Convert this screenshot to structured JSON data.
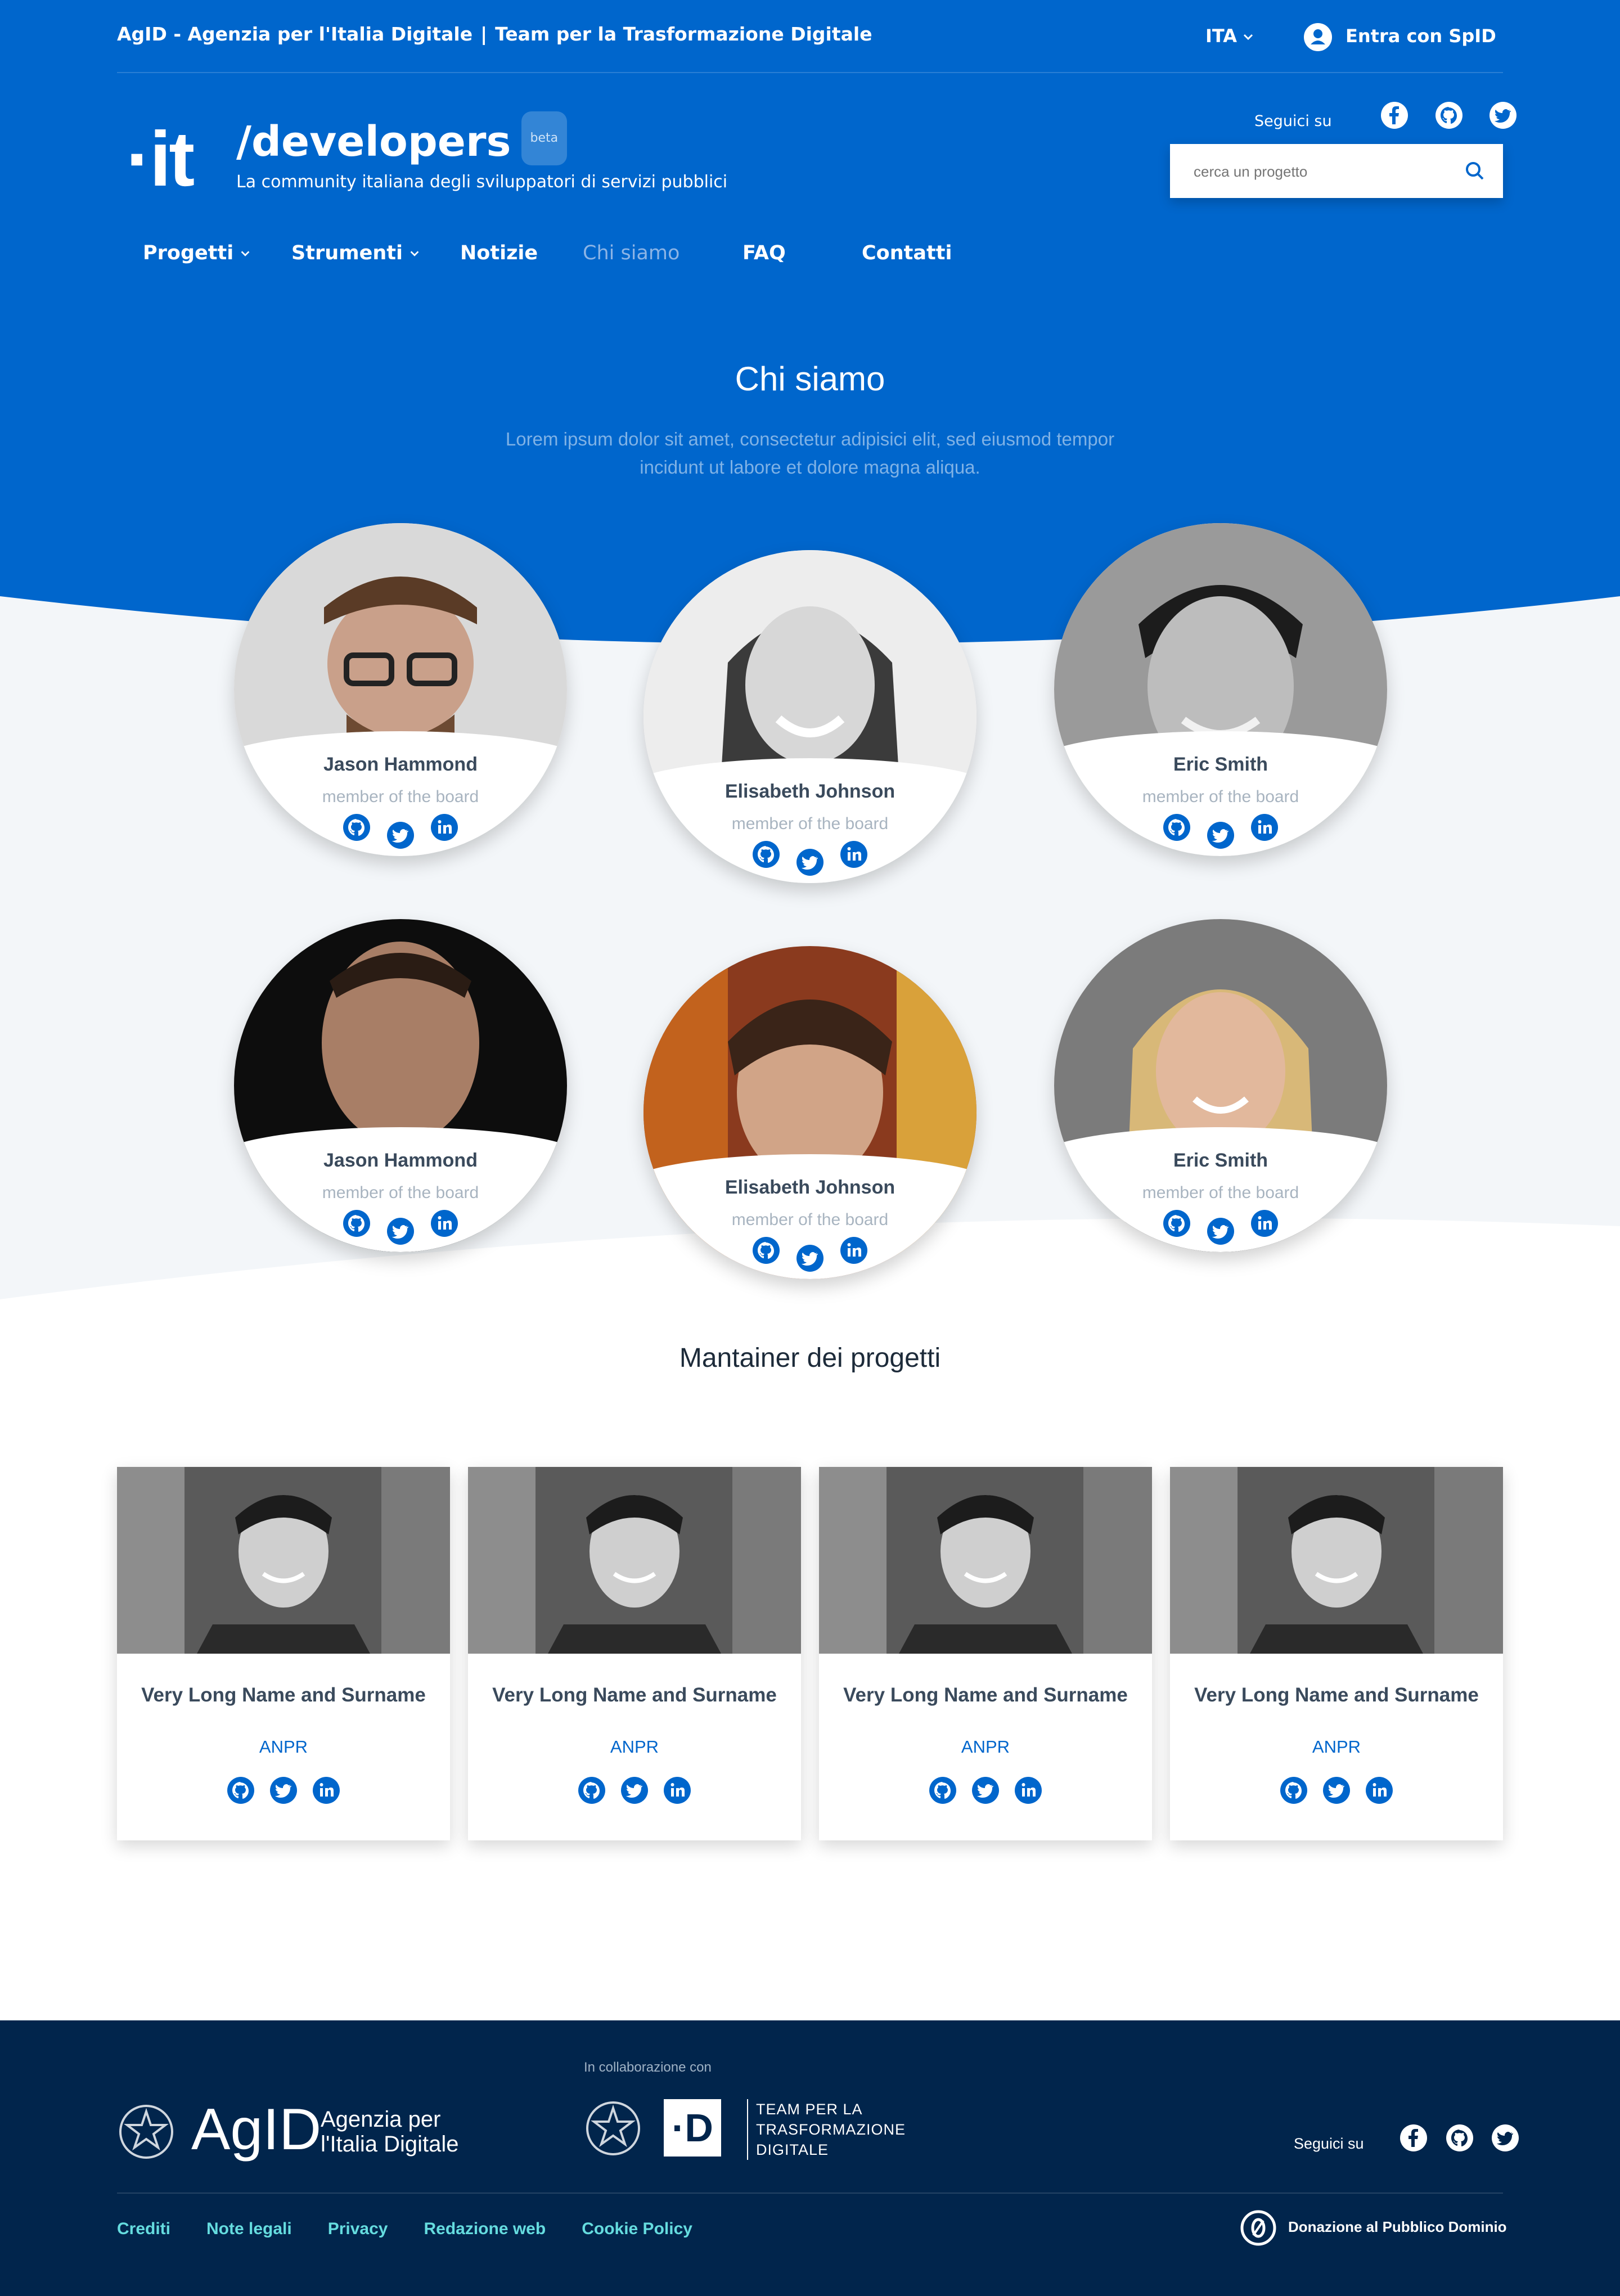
{
  "slim": {
    "agency": "AgID - Agenzia per l'Italia Digitale",
    "separator": "|",
    "team": "Team per la Trasformazione Digitale",
    "language": "ITA",
    "login": "Entra con SpID"
  },
  "header": {
    "logo": "·it",
    "title": "/developers",
    "badge": "beta",
    "subtitle": "La community italiana degli sviluppatori di servizi pubblici",
    "follow_label": "Seguici su",
    "social_icons": [
      "facebook-icon",
      "github-icon",
      "twitter-icon"
    ],
    "search_placeholder": "cerca un progetto"
  },
  "nav": {
    "items": [
      {
        "label": "Progetti",
        "dropdown": true
      },
      {
        "label": "Strumenti",
        "dropdown": true
      },
      {
        "label": "Notizie"
      },
      {
        "label": "Chi siamo",
        "active": true
      },
      {
        "label": "FAQ"
      },
      {
        "label": "Contatti"
      }
    ]
  },
  "hero": {
    "title": "Chi siamo",
    "subtitle": "Lorem ipsum dolor sit amet, consectetur adipisici elit, sed eiusmod tempor incidunt ut labore et dolore magna aliqua."
  },
  "members": [
    {
      "name": "Jason Hammond",
      "role": "member of the board"
    },
    {
      "name": "Elisabeth Johnson",
      "role": "member of the board"
    },
    {
      "name": "Eric Smith",
      "role": "member of the board"
    },
    {
      "name": "Jason Hammond",
      "role": "member of the board"
    },
    {
      "name": "Elisabeth Johnson",
      "role": "member of the board"
    },
    {
      "name": "Eric Smith",
      "role": "member of the board"
    }
  ],
  "maintainers": {
    "title": "Mantainer dei progetti",
    "cards": [
      {
        "name": "Very Long Name and Surname",
        "project": "ANPR"
      },
      {
        "name": "Very Long Name and Surname",
        "project": "ANPR"
      },
      {
        "name": "Very Long Name and Surname",
        "project": "ANPR"
      },
      {
        "name": "Very Long Name and Surname",
        "project": "ANPR"
      }
    ]
  },
  "footer": {
    "agid_big": "AgID",
    "agid_small_1": "Agenzia per",
    "agid_small_2": "l'Italia Digitale",
    "collab_label": "In collaborazione con",
    "team_logo": "·D",
    "team_line_1": "TEAM PER LA",
    "team_line_2": "TRASFORMAZIONE",
    "team_line_3": "DIGITALE",
    "follow_label": "Seguici su",
    "links": [
      "Crediti",
      "Note legali",
      "Privacy",
      "Redazione web",
      "Cookie Policy"
    ],
    "public_domain": "Donazione al Pubblico Dominio"
  },
  "colors": {
    "primary": "#0066cc",
    "footer_bg": "#01254c",
    "footer_link": "#65dcdf",
    "section_bg": "#f3f6f9"
  }
}
